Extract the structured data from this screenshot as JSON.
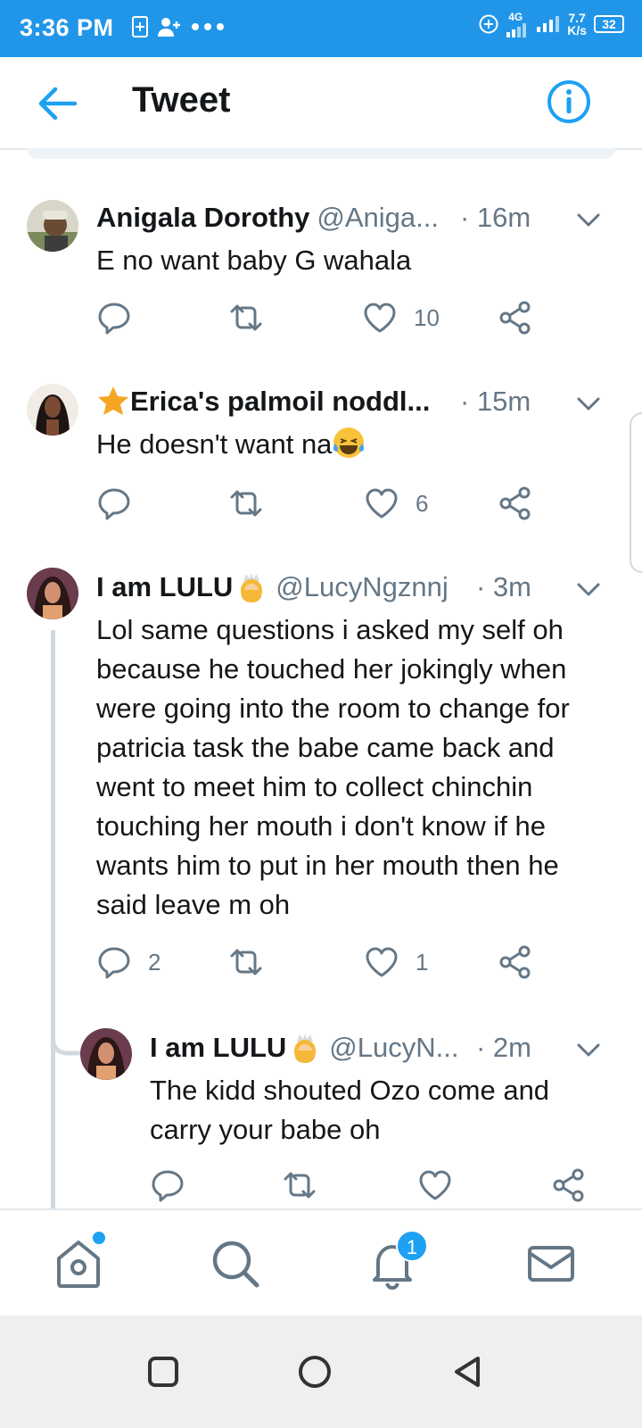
{
  "status_bar": {
    "time": "3:36 PM",
    "network": "4G",
    "speed_value": "7.7",
    "speed_unit": "K/s",
    "battery": "32"
  },
  "header": {
    "title": "Tweet"
  },
  "tweets": [
    {
      "name": "Anigala Dorothy",
      "handle": "@Aniga...",
      "time": "· 16m",
      "text": "E no want baby G wahala",
      "replies": "",
      "retweets": "",
      "likes": "10"
    },
    {
      "name": "Erica's palmoil noddl...",
      "handle": "",
      "time": "· 15m",
      "text": "He doesn't want na",
      "replies": "",
      "retweets": "",
      "likes": "6"
    },
    {
      "name": "I am LULU",
      "handle": "@LucyNgznnj",
      "time": "· 3m",
      "text": "Lol same questions i asked my self oh because he touched her jokingly when were going into the room to change for patricia task the babe came back and went to meet him to collect chinchin touching her mouth i don't know if he wants him to put in her mouth then he said leave m oh",
      "replies": "2",
      "retweets": "",
      "likes": "1"
    },
    {
      "name": "I am LULU",
      "handle": "@LucyN...",
      "time": "· 2m",
      "text": "The kidd shouted Ozo come and carry your babe oh",
      "replies": "",
      "retweets": "",
      "likes": ""
    }
  ],
  "bottom_nav": {
    "notifications_badge": "1"
  },
  "colors": {
    "accent": "#1da1f2",
    "status_bar": "#2196e8",
    "muted": "#657786"
  }
}
